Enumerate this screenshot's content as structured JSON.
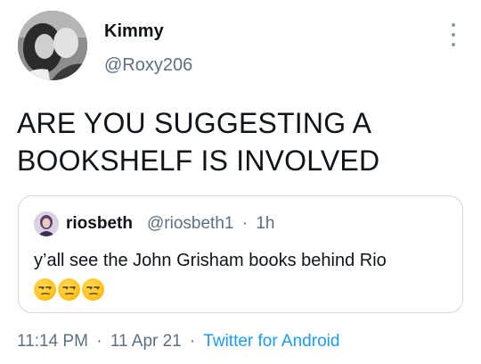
{
  "tweet": {
    "display_name": "Kimmy",
    "handle": "@Roxy206",
    "text": "ARE YOU SUGGESTING A BOOKSHELF IS INVOLVED",
    "quoted": {
      "display_name": "riosbeth",
      "handle": "@riosbeth1",
      "separator": "·",
      "time": "1h",
      "text": "y’all see the John Grisham books behind Rio",
      "emojis": [
        "unamused-face-icon",
        "unamused-face-icon",
        "unamused-face-icon"
      ]
    },
    "footer": {
      "time": "11:14 PM",
      "separator": "·",
      "date": "11 Apr 21",
      "source": "Twitter for Android"
    }
  },
  "colors": {
    "text": "#0f1419",
    "secondary": "#5b7083",
    "link": "#1d9bf0",
    "border": "#cfd9de"
  }
}
